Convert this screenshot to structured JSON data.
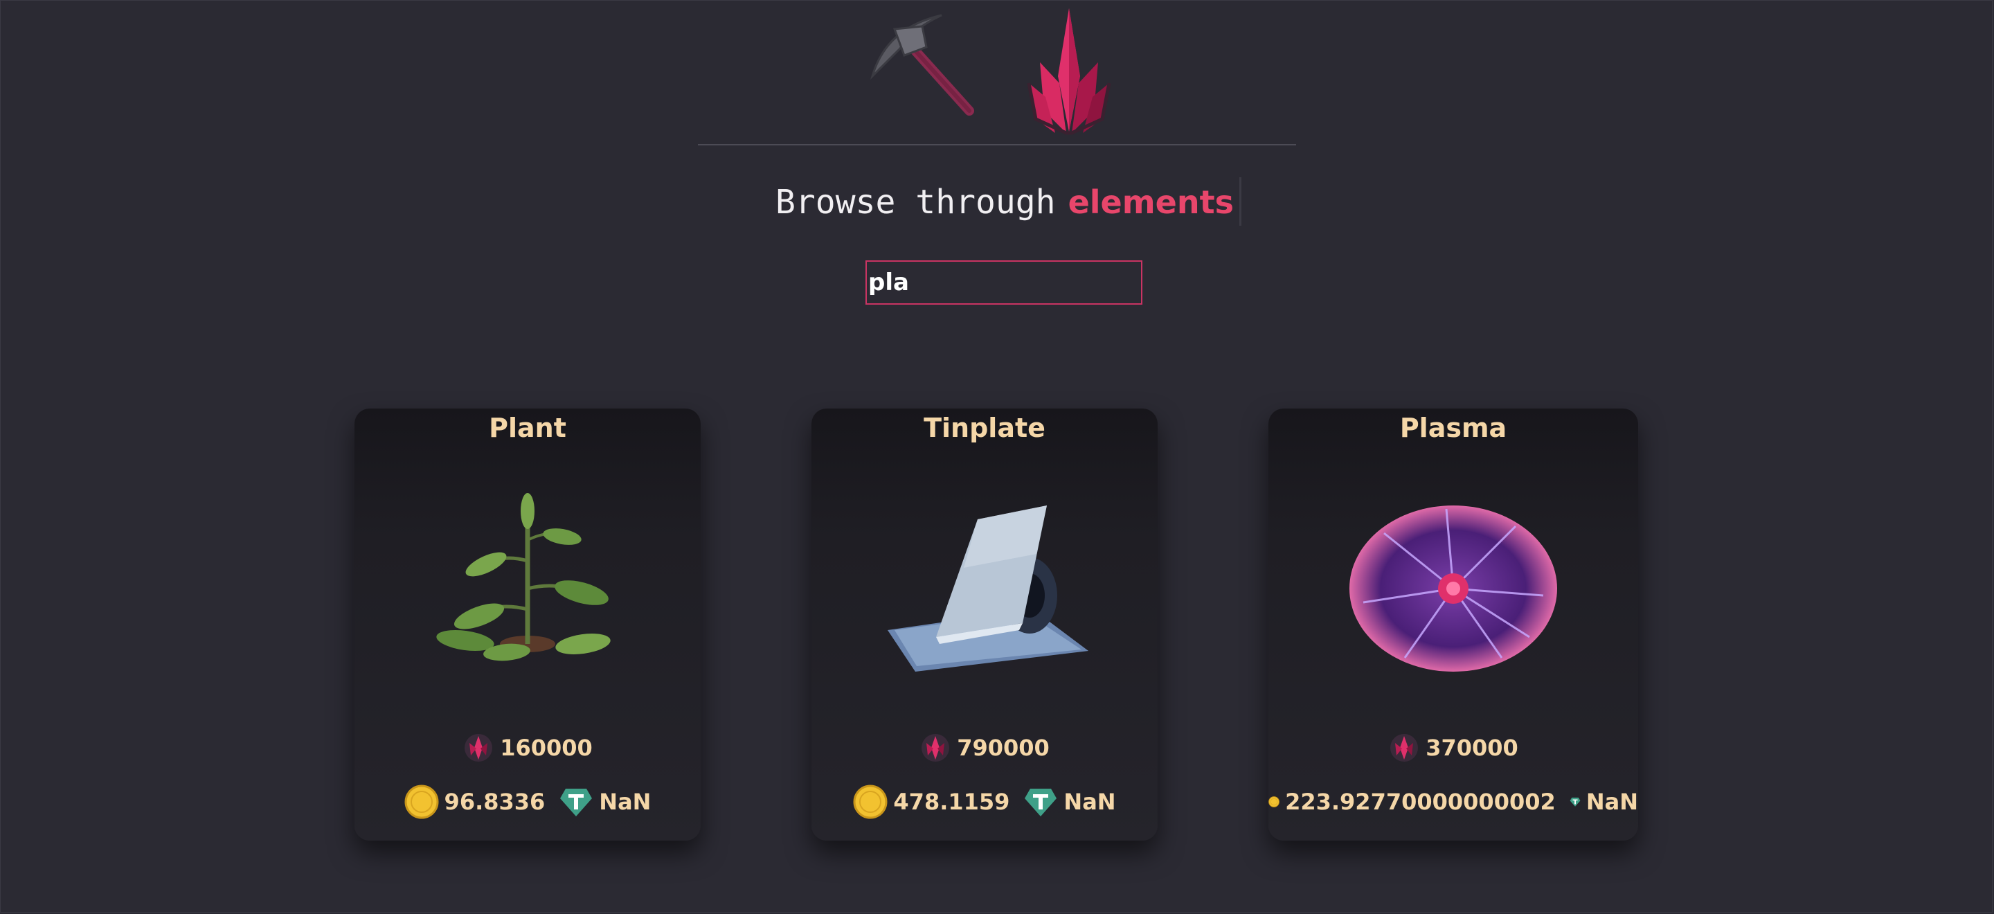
{
  "header": {
    "heading_plain": "Browse through",
    "heading_accent": "elements"
  },
  "search": {
    "value": "pla",
    "placeholder": ""
  },
  "cards": [
    {
      "title": "Plant",
      "price": "160000",
      "gold": "96.8336",
      "usdt": "NaN",
      "image_icon": "plant-icon"
    },
    {
      "title": "Tinplate",
      "price": "790000",
      "gold": "478.1159",
      "usdt": "NaN",
      "image_icon": "tinplate-icon"
    },
    {
      "title": "Plasma",
      "price": "370000",
      "gold": "223.92770000000002",
      "usdt": "NaN",
      "image_icon": "plasma-ball-icon"
    }
  ],
  "colors": {
    "background": "#2b2a33",
    "accent": "#e8466b",
    "card_text": "#f5d7a8",
    "search_border": "#c93463"
  }
}
